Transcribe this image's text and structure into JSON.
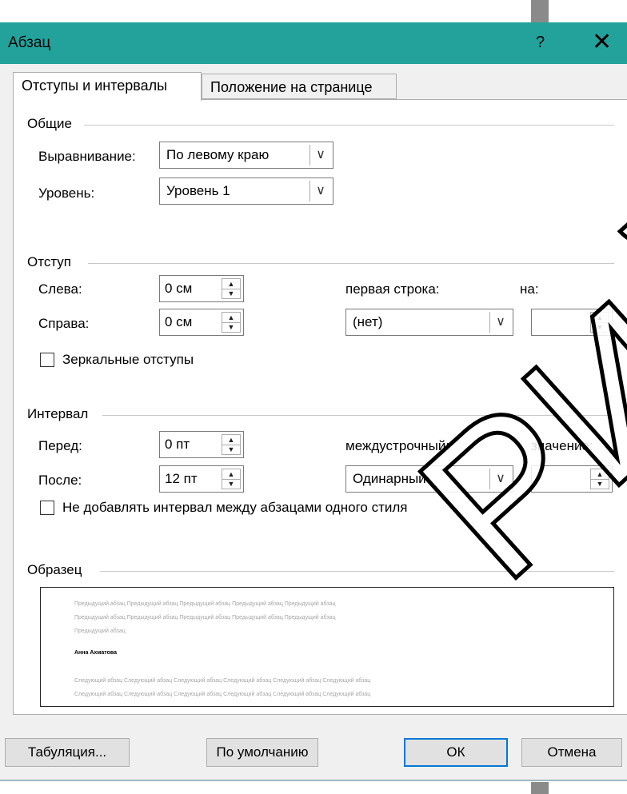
{
  "dialog": {
    "title": "Абзац",
    "help_label": "?",
    "close_label": "✕"
  },
  "tabs": [
    {
      "label": "Отступы и интервалы",
      "active": true
    },
    {
      "label": "Положение на странице",
      "active": false
    }
  ],
  "general": {
    "section": "Общие",
    "alignment_label": "Выравнивание:",
    "alignment_value": "По левому краю",
    "level_label": "Уровень:",
    "level_value": "Уровень 1"
  },
  "indent": {
    "section": "Отступ",
    "left_label": "Слева:",
    "left_value": "0 см",
    "right_label": "Справа:",
    "right_value": "0 см",
    "first_line_label": "первая строка:",
    "first_line_value": "(нет)",
    "by_label": "на:",
    "by_value": "",
    "mirror_label": "Зеркальные отступы",
    "mirror_checked": false
  },
  "spacing": {
    "section": "Интервал",
    "before_label": "Перед:",
    "before_value": "0 пт",
    "after_label": "После:",
    "after_value": "12 пт",
    "line_label": "междустрочный:",
    "line_value": "Одинарный",
    "at_label": "значение:",
    "at_value": "",
    "no_space_label": "Не добавлять интервал между абзацами одного стиля",
    "no_space_checked": false
  },
  "preview": {
    "section": "Образец",
    "prev_line1": "Предыдущий абзац Предыдущий абзац Предыдущий абзац Предыдущий абзац Предыдущий абзац",
    "prev_line2": "Предыдущий абзац Предыдущий абзац Предыдущий абзац Предыдущий абзац Предыдущий абзац",
    "prev_line3": "Предыдущий абзац",
    "current": "Анна Ахматова",
    "next_line1": "Следующий абзац Следующий абзац Следующий абзац Следующий абзац Следующий абзац Следующий абзац",
    "next_line2": "Следующий абзац Следующий абзац Следующий абзац Следующий абзац Следующий абзац Следующий абзац"
  },
  "buttons": {
    "tabs": "Табуляция...",
    "default": "По умолчанию",
    "ok": "ОК",
    "cancel": "Отмена"
  },
  "watermark": "РИЙ БГУ",
  "icons": {
    "dropdown": "chevron-down-icon",
    "spin_up": "spin-up-icon",
    "spin_down": "spin-down-icon",
    "help": "help-icon",
    "close": "close-icon"
  }
}
